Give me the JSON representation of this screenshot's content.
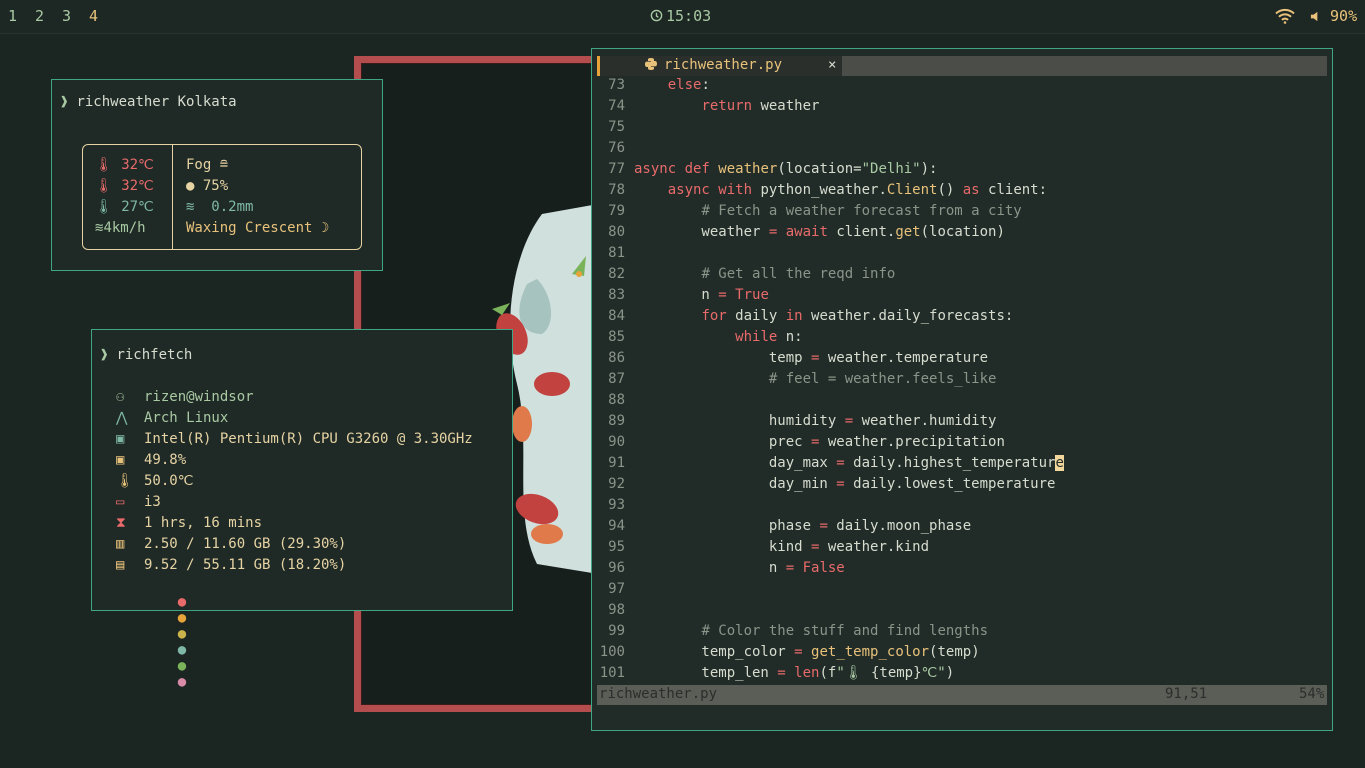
{
  "bar": {
    "workspaces": [
      "1",
      "2",
      "3",
      "4"
    ],
    "clock": "15:03",
    "volume": "90%"
  },
  "weather_term": {
    "prompt_symbol": "❱",
    "command": "richweather Kolkata",
    "left": [
      "32℃",
      "32℃",
      "27℃",
      "4km/h"
    ],
    "right": [
      "Fog",
      "75%",
      "0.2mm",
      "Waxing Crescent"
    ],
    "colors": {
      "temp": "#e86a6a",
      "feel": "#e86a6a",
      "min": "#7fb8a6",
      "wind": "#a9c9a3",
      "accent": "#e8c27a"
    }
  },
  "fetch_term": {
    "prompt_symbol": "❱",
    "command": "richfetch",
    "rows": [
      {
        "icon": "user-icon",
        "text": "rizen@windsor"
      },
      {
        "icon": "arch-icon",
        "text": "Arch Linux"
      },
      {
        "icon": "cpu-icon",
        "text": "Intel(R) Pentium(R) CPU G3260 @ 3.30GHz"
      },
      {
        "icon": "cpu-usage-icon",
        "text": "49.8%"
      },
      {
        "icon": "thermometer-icon",
        "text": "50.0℃"
      },
      {
        "icon": "desktop-icon",
        "text": "i3"
      },
      {
        "icon": "hourglass-icon",
        "text": "1 hrs, 16 mins"
      },
      {
        "icon": "memory-icon",
        "text": "2.50 / 11.60 GB (29.30%)"
      },
      {
        "icon": "disk-icon",
        "text": "9.52 / 55.11 GB (18.20%)"
      }
    ]
  },
  "editor": {
    "tab_name": "richweather.py",
    "close_label": "×",
    "status_file": "richweather.py",
    "status_pos": "91,51",
    "status_pct": "54%",
    "line_numbers": [
      "73",
      "74",
      "75",
      "76",
      "77",
      "78",
      "79",
      "80",
      "81",
      "82",
      "83",
      "84",
      "85",
      "86",
      "87",
      "88",
      "89",
      "90",
      "91",
      "92",
      "93",
      "94",
      "95",
      "96",
      "97",
      "98",
      "99",
      "100",
      "101"
    ]
  }
}
